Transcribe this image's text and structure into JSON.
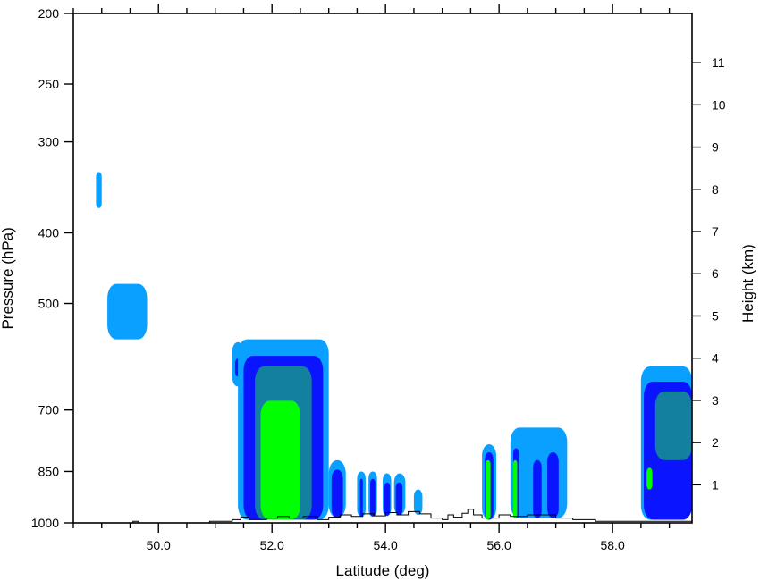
{
  "chart_data": {
    "type": "heatmap",
    "title": "",
    "xlabel": "Latitude (deg)",
    "ylabel_left": "Pressure (hPa)",
    "ylabel_right": "Height (km)",
    "xlim": [
      48.5,
      59.4
    ],
    "ylim_left": [
      1000,
      200
    ],
    "left_scale": "log",
    "grid": false,
    "legend": "none",
    "x_ticks": [
      {
        "value": 50.0,
        "label": "50.0"
      },
      {
        "value": 52.0,
        "label": "52.0"
      },
      {
        "value": 54.0,
        "label": "54.0"
      },
      {
        "value": 56.0,
        "label": "56.0"
      },
      {
        "value": 58.0,
        "label": "58.0"
      }
    ],
    "x_minor_step": 0.5,
    "left_ticks": [
      {
        "value": 200,
        "label": "200"
      },
      {
        "value": 250,
        "label": "250"
      },
      {
        "value": 300,
        "label": "300"
      },
      {
        "value": 400,
        "label": "400"
      },
      {
        "value": 500,
        "label": "500"
      },
      {
        "value": 700,
        "label": "700"
      },
      {
        "value": 850,
        "label": "850"
      },
      {
        "value": 1000,
        "label": "1000"
      }
    ],
    "right_ticks": [
      {
        "value": 1,
        "label": "1"
      },
      {
        "value": 2,
        "label": "2"
      },
      {
        "value": 3,
        "label": "3"
      },
      {
        "value": 4,
        "label": "4"
      },
      {
        "value": 5,
        "label": "5"
      },
      {
        "value": 6,
        "label": "6"
      },
      {
        "value": 7,
        "label": "7"
      },
      {
        "value": 8,
        "label": "8"
      },
      {
        "value": 9,
        "label": "9"
      },
      {
        "value": 10,
        "label": "10"
      },
      {
        "value": 11,
        "label": "11"
      }
    ],
    "level_colors": [
      "#0aa0ff",
      "#0a14ff",
      "#1480a0",
      "#00ff00"
    ],
    "cells": [
      {
        "lat": [
          48.9,
          49.0
        ],
        "p": [
          330,
          370
        ],
        "level": 1
      },
      {
        "lat": [
          49.1,
          49.8
        ],
        "p": [
          470,
          560
        ],
        "level": 1
      },
      {
        "lat": [
          51.3,
          51.5
        ],
        "p": [
          565,
          650
        ],
        "level": 1
      },
      {
        "lat": [
          51.35,
          51.45
        ],
        "p": [
          595,
          630
        ],
        "level": 2
      },
      {
        "lat": [
          51.4,
          53.0
        ],
        "p": [
          560,
          990
        ],
        "level": 1
      },
      {
        "lat": [
          51.5,
          52.9
        ],
        "p": [
          590,
          990
        ],
        "level": 2
      },
      {
        "lat": [
          51.7,
          52.7
        ],
        "p": [
          610,
          990
        ],
        "level": 3
      },
      {
        "lat": [
          51.8,
          52.5
        ],
        "p": [
          680,
          990
        ],
        "level": 4
      },
      {
        "lat": [
          53.0,
          53.3
        ],
        "p": [
          820,
          985
        ],
        "level": 1
      },
      {
        "lat": [
          53.05,
          53.25
        ],
        "p": [
          845,
          985
        ],
        "level": 2
      },
      {
        "lat": [
          53.5,
          53.65
        ],
        "p": [
          850,
          980
        ],
        "level": 1
      },
      {
        "lat": [
          53.55,
          53.6
        ],
        "p": [
          870,
          980
        ],
        "level": 2
      },
      {
        "lat": [
          53.7,
          53.85
        ],
        "p": [
          850,
          980
        ],
        "level": 1
      },
      {
        "lat": [
          53.73,
          53.82
        ],
        "p": [
          870,
          980
        ],
        "level": 2
      },
      {
        "lat": [
          53.95,
          54.1
        ],
        "p": [
          855,
          978
        ],
        "level": 1
      },
      {
        "lat": [
          53.98,
          54.08
        ],
        "p": [
          880,
          978
        ],
        "level": 2
      },
      {
        "lat": [
          54.15,
          54.35
        ],
        "p": [
          855,
          975
        ],
        "level": 1
      },
      {
        "lat": [
          54.18,
          54.3
        ],
        "p": [
          880,
          975
        ],
        "level": 2
      },
      {
        "lat": [
          54.5,
          54.65
        ],
        "p": [
          900,
          975
        ],
        "level": 1
      },
      {
        "lat": [
          55.7,
          55.95
        ],
        "p": [
          780,
          990
        ],
        "level": 1
      },
      {
        "lat": [
          55.75,
          55.9
        ],
        "p": [
          800,
          990
        ],
        "level": 2
      },
      {
        "lat": [
          55.76,
          55.85
        ],
        "p": [
          820,
          990
        ],
        "level": 4
      },
      {
        "lat": [
          56.2,
          57.2
        ],
        "p": [
          740,
          985
        ],
        "level": 1
      },
      {
        "lat": [
          56.25,
          56.35
        ],
        "p": [
          790,
          985
        ],
        "level": 2
      },
      {
        "lat": [
          56.25,
          56.32
        ],
        "p": [
          820,
          985
        ],
        "level": 4
      },
      {
        "lat": [
          56.6,
          56.75
        ],
        "p": [
          820,
          985
        ],
        "level": 2
      },
      {
        "lat": [
          56.85,
          57.05
        ],
        "p": [
          800,
          985
        ],
        "level": 2
      },
      {
        "lat": [
          58.5,
          59.4
        ],
        "p": [
          610,
          990
        ],
        "level": 1
      },
      {
        "lat": [
          58.55,
          59.4
        ],
        "p": [
          640,
          990
        ],
        "level": 2
      },
      {
        "lat": [
          58.75,
          59.4
        ],
        "p": [
          660,
          820
        ],
        "level": 3
      },
      {
        "lat": [
          58.6,
          58.7
        ],
        "p": [
          840,
          900
        ],
        "level": 4
      }
    ],
    "terrain_profile": [
      [
        48.5,
        1000
      ],
      [
        49.55,
        1000
      ],
      [
        49.55,
        995
      ],
      [
        49.65,
        995
      ],
      [
        49.65,
        1000
      ],
      [
        50.9,
        1000
      ],
      [
        50.9,
        995
      ],
      [
        51.3,
        995
      ],
      [
        51.3,
        990
      ],
      [
        51.45,
        990
      ],
      [
        51.45,
        982
      ],
      [
        51.6,
        982
      ],
      [
        51.6,
        990
      ],
      [
        51.9,
        990
      ],
      [
        51.9,
        985
      ],
      [
        52.1,
        985
      ],
      [
        52.1,
        980
      ],
      [
        52.3,
        980
      ],
      [
        52.3,
        985
      ],
      [
        52.55,
        985
      ],
      [
        52.55,
        980
      ],
      [
        52.8,
        980
      ],
      [
        52.8,
        990
      ],
      [
        53.0,
        990
      ],
      [
        53.0,
        982
      ],
      [
        53.2,
        982
      ],
      [
        53.2,
        975
      ],
      [
        53.4,
        975
      ],
      [
        53.4,
        980
      ],
      [
        53.6,
        980
      ],
      [
        53.6,
        972
      ],
      [
        53.8,
        972
      ],
      [
        53.8,
        978
      ],
      [
        54.0,
        978
      ],
      [
        54.0,
        968
      ],
      [
        54.2,
        968
      ],
      [
        54.2,
        975
      ],
      [
        54.4,
        975
      ],
      [
        54.4,
        965
      ],
      [
        54.6,
        965
      ],
      [
        54.6,
        972
      ],
      [
        54.8,
        972
      ],
      [
        54.8,
        985
      ],
      [
        55.0,
        985
      ],
      [
        55.0,
        990
      ],
      [
        55.1,
        990
      ],
      [
        55.1,
        975
      ],
      [
        55.2,
        975
      ],
      [
        55.2,
        982
      ],
      [
        55.35,
        982
      ],
      [
        55.35,
        970
      ],
      [
        55.45,
        970
      ],
      [
        55.45,
        958
      ],
      [
        55.55,
        958
      ],
      [
        55.55,
        975
      ],
      [
        55.7,
        975
      ],
      [
        55.7,
        985
      ],
      [
        56.0,
        985
      ],
      [
        56.0,
        975
      ],
      [
        56.2,
        975
      ],
      [
        56.2,
        980
      ],
      [
        56.5,
        980
      ],
      [
        56.5,
        975
      ],
      [
        57.0,
        975
      ],
      [
        57.0,
        985
      ],
      [
        57.3,
        985
      ],
      [
        57.3,
        990
      ],
      [
        57.7,
        990
      ],
      [
        57.7,
        995
      ],
      [
        59.4,
        995
      ]
    ]
  }
}
